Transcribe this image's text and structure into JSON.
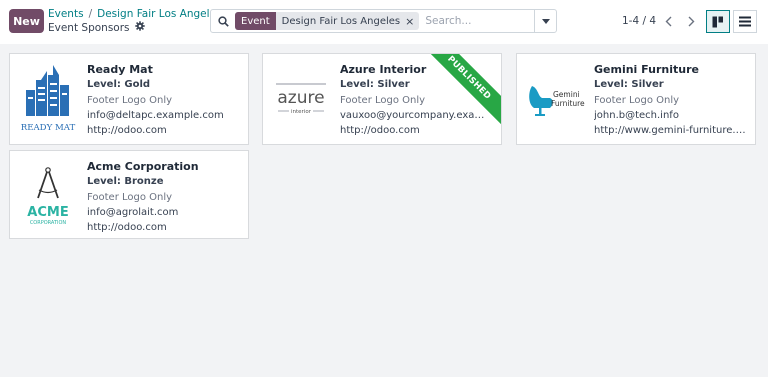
{
  "control_panel": {
    "new_label": "New",
    "breadcrumb_root": "Events",
    "breadcrumb_separator": "/",
    "breadcrumb_current": "Design Fair Los Angeles",
    "subtitle": "Event Sponsors"
  },
  "search": {
    "facet_tag": "Event",
    "facet_value": "Design Fair Los Angeles",
    "facet_remove": "×",
    "placeholder": "Search..."
  },
  "pager": {
    "value": "1-4 / 4"
  },
  "views": [
    "kanban",
    "list"
  ],
  "cards": [
    {
      "name": "Ready Mat",
      "level": "Level: Gold",
      "display": "Footer Logo Only",
      "email": "info@deltapc.example.com",
      "website": "http://odoo.com",
      "logo_text": "READY MAT",
      "published": false
    },
    {
      "name": "Azure Interior",
      "level": "Level: Silver",
      "display": "Footer Logo Only",
      "email": "vauxoo@yourcompany.example.com",
      "website": "http://odoo.com",
      "logo_text": "azure",
      "logo_subtext": "interior",
      "published": true,
      "ribbon": "PUBLISHED"
    },
    {
      "name": "Gemini Furniture",
      "level": "Level: Silver",
      "display": "Footer Logo Only",
      "email": "john.b@tech.info",
      "website": "http://www.gemini-furniture.com/",
      "logo_text": "Gemini",
      "logo_subtext": "Furniture",
      "published": false
    },
    {
      "name": "Acme Corporation",
      "level": "Level: Bronze",
      "display": "Footer Logo Only",
      "email": "info@agrolait.com",
      "website": "http://odoo.com",
      "logo_text": "ACME",
      "logo_subtext": "CORPORATION",
      "published": false
    }
  ],
  "colors": {
    "brand": "#714b67",
    "link": "#017e84",
    "ribbon": "#28a745"
  }
}
